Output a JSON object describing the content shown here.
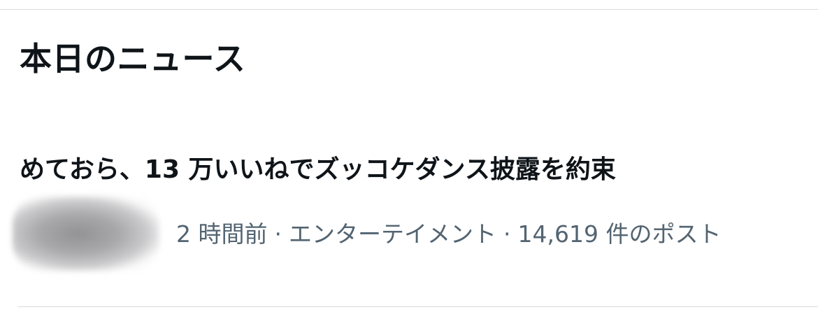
{
  "section": {
    "title": "本日のニュース"
  },
  "news_item": {
    "headline": "めておら、13 万いいねでズッコケダンス披露を約束",
    "time": "2 時間前",
    "separator": "·",
    "category": "エンターテイメント",
    "post_count": "14,619 件のポスト"
  }
}
